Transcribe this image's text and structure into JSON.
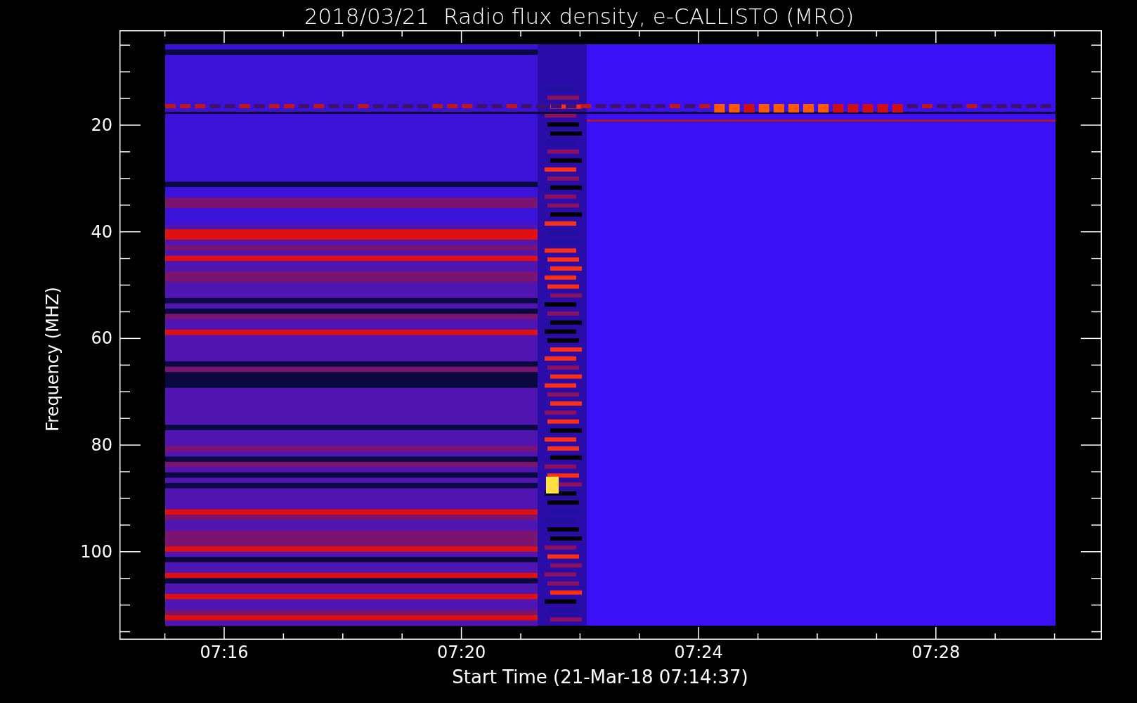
{
  "title": "2018/03/21  Radio flux density, e-CALLISTO (MRO)",
  "y_axis": {
    "label": "Frequency (MHZ)",
    "tick_labels": [
      "20",
      "40",
      "60",
      "80",
      "100"
    ]
  },
  "x_axis": {
    "label": "Start Time (21-Mar-18 07:14:37)",
    "tick_labels": [
      "07:16",
      "07:20",
      "07:24",
      "07:28"
    ]
  }
}
